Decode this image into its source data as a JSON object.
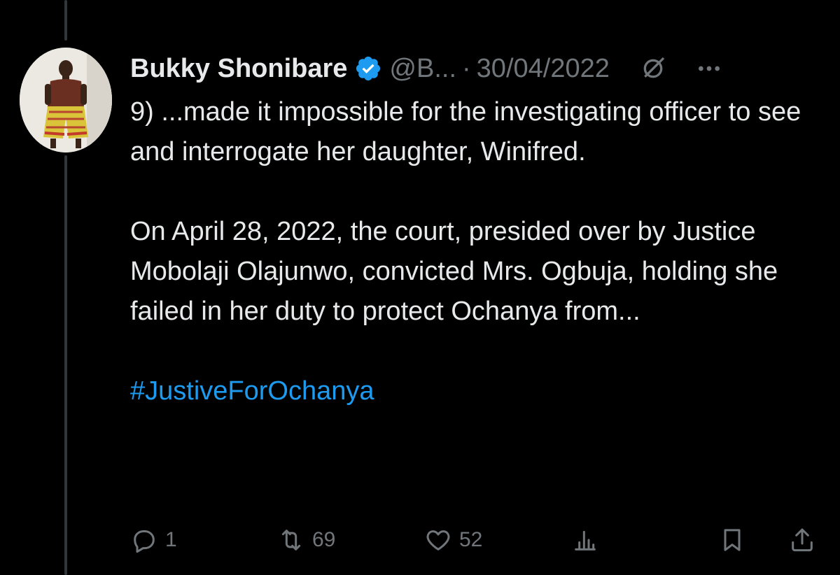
{
  "tweet": {
    "author_name": "Bukky Shonibare",
    "handle": "@B...",
    "separator": "·",
    "date": "30/04/2022",
    "paragraphs": [
      "9) ...made it impossible for the investigating officer to see and interrogate her daughter, Winifred.",
      "On April 28, 2022, the court, presided over by Justice Mobolaji Olajunwo, convicted Mrs. Ogbuja, holding she failed in her duty to protect Ochanya from..."
    ],
    "hashtag": "#JustiveForOchanya"
  },
  "actions": {
    "replies": "1",
    "reposts": "69",
    "likes": "52"
  },
  "icons": {
    "verified": "verified-badge-icon",
    "grok": "grok-icon",
    "more": "more-icon",
    "reply": "reply-icon",
    "repost": "repost-icon",
    "like": "heart-icon",
    "views": "views-icon",
    "bookmark": "bookmark-icon",
    "share": "share-icon"
  },
  "colors": {
    "background": "#000000",
    "text": "#e7e9ea",
    "muted": "#71767b",
    "accent": "#1d9bf0"
  }
}
